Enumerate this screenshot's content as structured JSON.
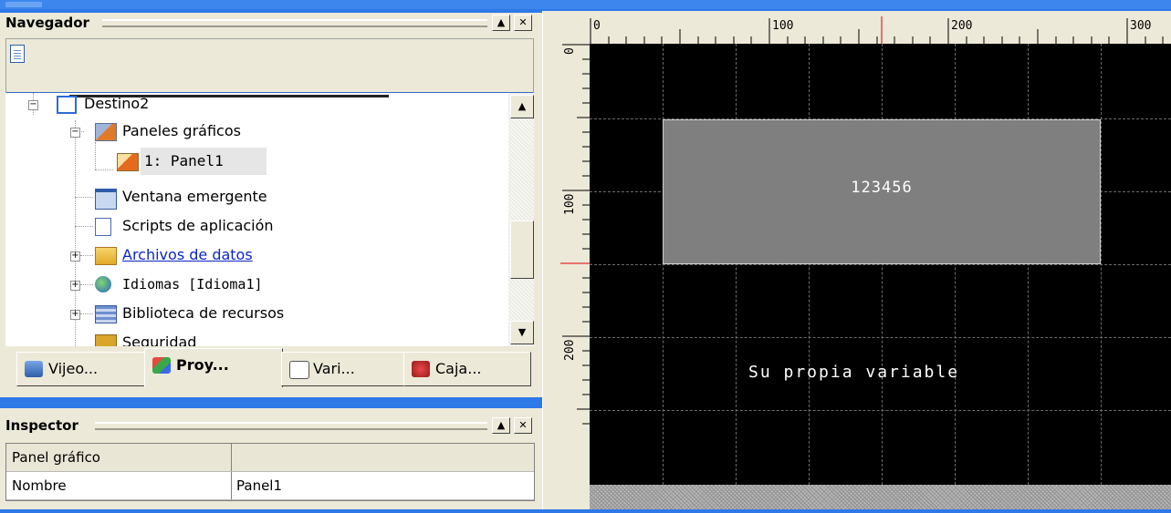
{
  "navigator": {
    "title": "Navegador",
    "tree": [
      {
        "label": "Destino2"
      },
      {
        "label": "Paneles gráficos"
      },
      {
        "label": "1: Panel1"
      },
      {
        "label": "Ventana emergente"
      },
      {
        "label": "Scripts de aplicación"
      },
      {
        "label": "Archivos de datos"
      },
      {
        "label": "Idiomas [Idioma1]"
      },
      {
        "label": "Biblioteca de recursos"
      },
      {
        "label": "Seguridad"
      }
    ],
    "tabs": [
      {
        "label": "Vijeo..."
      },
      {
        "label": "Proy..."
      },
      {
        "label": "Vari..."
      },
      {
        "label": "Caja..."
      }
    ]
  },
  "inspector": {
    "title": "Inspector",
    "rows": [
      {
        "property": "Panel gráfico",
        "value": ""
      },
      {
        "property": "Nombre",
        "value": "Panel1"
      }
    ]
  },
  "ruler": {
    "top_labels": [
      "0",
      "100",
      "200",
      "300"
    ],
    "left_labels": [
      "0",
      "100",
      "200"
    ]
  },
  "canvas": {
    "display_value": "123456",
    "variable_text": "Su propia variable",
    "background": "#000000",
    "display_color": "#7f7f7f"
  },
  "colors": {
    "desktop": "#2e78e8",
    "chrome": "#ece9d8",
    "selection_border": "#316ac5"
  }
}
